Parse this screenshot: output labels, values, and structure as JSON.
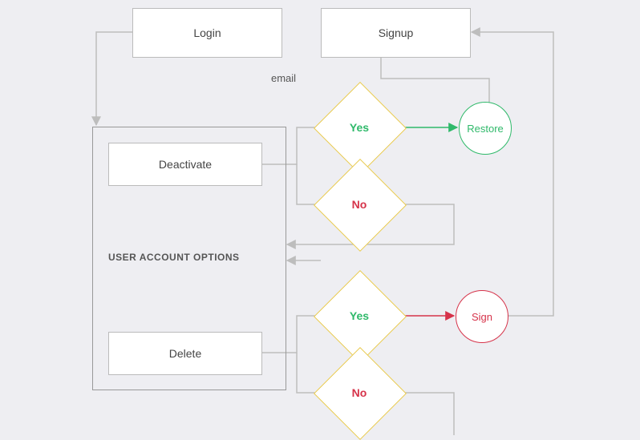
{
  "nodes": {
    "login": "Login",
    "signup": "Signup",
    "deactivate": "Deactivate",
    "delete": "Delete",
    "restore": "Restore",
    "sign": "Sign"
  },
  "decisions": {
    "yes": "Yes",
    "no": "No"
  },
  "group": {
    "label": "USER ACCOUNT OPTIONS"
  },
  "edges": {
    "email": "email"
  },
  "colors": {
    "yes": "#2fb96a",
    "no": "#d6334a",
    "diamond_border": "#e8c94a",
    "connector": "#bdbdbd"
  }
}
